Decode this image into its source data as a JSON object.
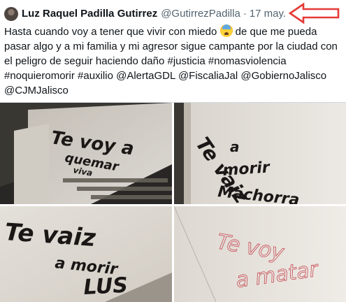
{
  "author": {
    "name": "Luz Raquel Padilla Gutirrez",
    "handle": "@GutirrezPadilla",
    "separator": "·",
    "date": "17 may."
  },
  "tweet": {
    "line1_a": "Hasta cuando voy a tener que vivir con miedo",
    "emoji": "anxious-face-with-sweat-emoji",
    "line1_b": " de que me pueda",
    "line2": "pasar algo y a mi familia y mi agresor sigue campante por la ciudad con",
    "line3": "el peligro de seguir haciendo daño #justicia #nomasviolencia",
    "line4": "#noquieromorir #auxilio @AlertaGDL @FiscaliaJal @GobiernoJalisco",
    "line5": "@CJMJalisco"
  },
  "media": {
    "photo1": {
      "line1": "Te voy a",
      "line2": "quemar",
      "line3": "viva"
    },
    "photo2": {
      "line1": "Te vaiz",
      "line2": "a",
      "line3": "morir",
      "line4": "Machorra"
    },
    "photo3": {
      "line1": "Te vaiz",
      "line2": "a morir",
      "line3": "LUS"
    },
    "photo4": {
      "line1": "Te voy",
      "line2": "a matar"
    }
  },
  "colors": {
    "text": "#0f1419",
    "secondary": "#536471",
    "arrow": "#e53935",
    "wall": "#e8e4de",
    "spray_black": "#1a1716",
    "spray_red": "#c84b55"
  }
}
